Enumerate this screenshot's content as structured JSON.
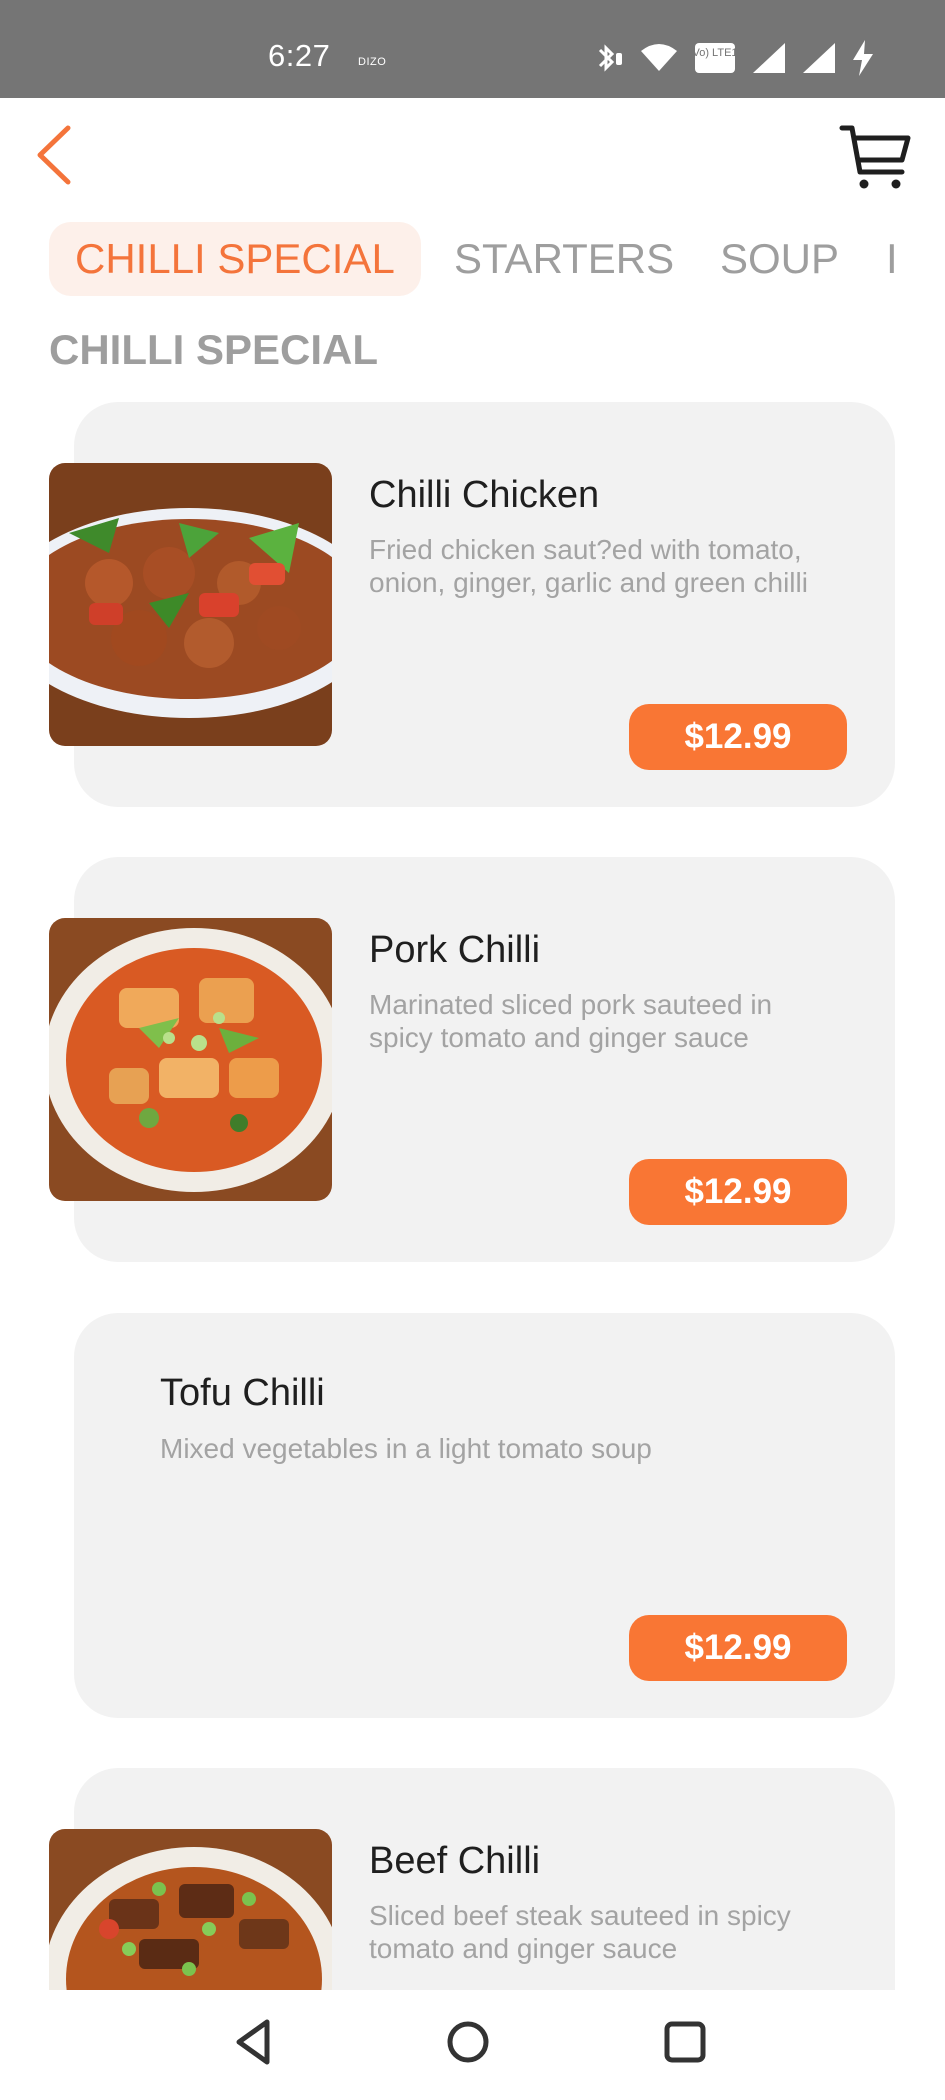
{
  "status_bar": {
    "time": "6:27",
    "carrier": "DIZO",
    "volte_label": "Vo) LTE1",
    "icons": [
      "bluetooth-icon",
      "wifi-icon",
      "volte-icon",
      "signal-icon",
      "signal-icon",
      "charging-icon"
    ]
  },
  "app_bar": {
    "back_icon": "chevron-left-icon",
    "cart_icon": "cart-icon",
    "accent_color": "#f4743b"
  },
  "tabs": [
    {
      "label": "CHILLI SPECIAL",
      "active": true
    },
    {
      "label": "STARTERS",
      "active": false
    },
    {
      "label": "SOUP",
      "active": false
    },
    {
      "label": "I",
      "active": false
    }
  ],
  "section_title": "CHILLI SPECIAL",
  "menu_items": [
    {
      "name": "Chilli Chicken",
      "description_line1": "Fried chicken saut?ed with tomato,",
      "description_line2": "onion, ginger, garlic and green chilli",
      "price": "$12.99",
      "has_image": true
    },
    {
      "name": "Pork Chilli",
      "description_line1": "Marinated sliced pork sauteed in",
      "description_line2": "spicy tomato and ginger sauce",
      "price": "$12.99",
      "has_image": true
    },
    {
      "name": "Tofu Chilli",
      "description_line1": "Mixed vegetables in a light tomato soup",
      "description_line2": "",
      "price": "$12.99",
      "has_image": false
    },
    {
      "name": "Beef Chilli",
      "description_line1": "Sliced beef steak sauteed in spicy",
      "description_line2": "tomato and ginger sauce",
      "price": "",
      "has_image": true
    }
  ],
  "nav_bar": {
    "icons": [
      "back-triangle-icon",
      "home-circle-icon",
      "recents-square-icon"
    ]
  },
  "colors": {
    "price_button": "#f97634",
    "card_background": "#f2f2f2",
    "active_tab_background": "#fdf0ea",
    "status_bar": "#757575"
  }
}
